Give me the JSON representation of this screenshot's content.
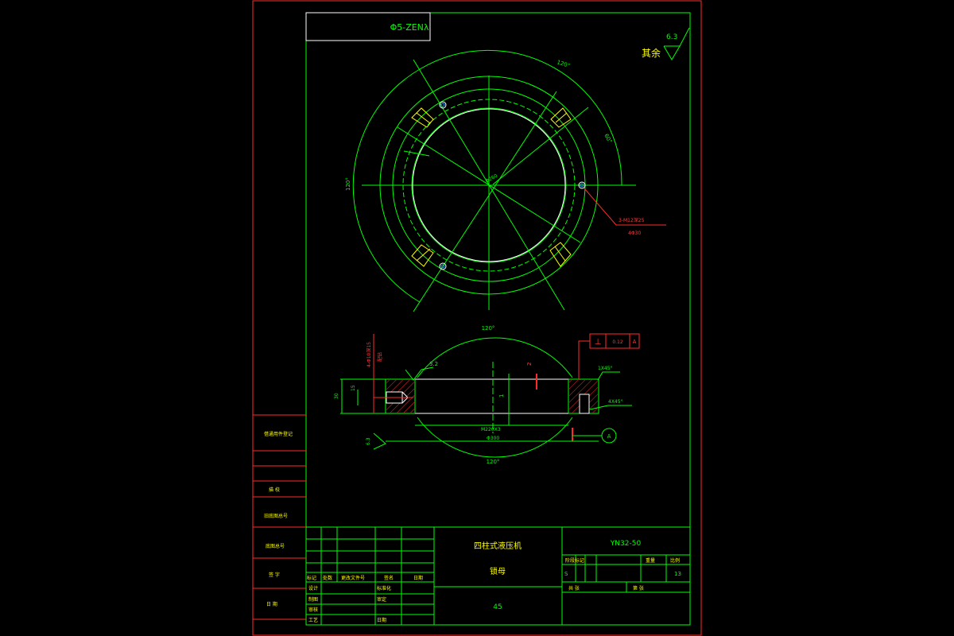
{
  "title_block": {
    "top_code": "Φ5-ZENλ",
    "machine_name": "四柱式液压机",
    "part_name": "锁母",
    "material": "45",
    "drawing_no": "YN32-50",
    "col_stage": "阶段标记",
    "col_weight": "重量",
    "col_scale": "比例",
    "stage_value": "S",
    "scale_value": "13",
    "sheet_total": "共  张",
    "sheet_no": "第  张",
    "rev_marker": "标记",
    "rev_count": "处数",
    "rev_doc": "更改文件号",
    "rev_sign": "签名",
    "rev_date": "日期",
    "role_design": "设计",
    "role_draw": "制图",
    "role_check": "审核",
    "role_process": "工艺",
    "role_std": "标准化",
    "role_approve": "审定",
    "role_date": "日期"
  },
  "side_block": {
    "l1": "借通用件登记",
    "l2": "描 校",
    "l3": "旧底图总号",
    "l4": "底图总号",
    "l5": "签 字",
    "l6": "日 期"
  },
  "annotations": {
    "roughness_rest": "其余",
    "roughness_value": "6.3",
    "angle_top": "120°",
    "angle_right": "60°",
    "angle_left": "120°",
    "hole_callout": "3-M12深25",
    "hole_callout2": "4Φ30",
    "pcd": "Φ260",
    "tol_symbol": "⊥",
    "tol_value": "0.12",
    "tol_datum": "A",
    "chamfer1": "1X45°",
    "chamfer2": "4X45°",
    "sec_angle_top": "120°",
    "sec_angle_bottom": "120°",
    "thread": "M220X3",
    "outer_dia": "Φ300",
    "height": "30",
    "depth": "15",
    "roughness_sec": "3.2",
    "roughness_side": "6.3",
    "dim_2": "2",
    "dim_1": "1",
    "pin_callout": "4-Φ10深15",
    "pin_extra": "配钻",
    "datum_circle": "A"
  }
}
